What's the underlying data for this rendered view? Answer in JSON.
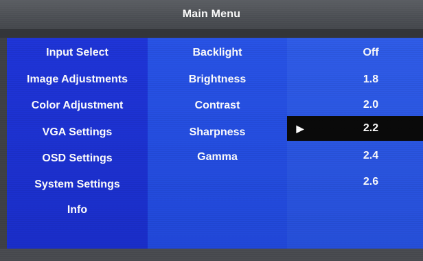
{
  "header": {
    "title": "Main Menu"
  },
  "left_menu": {
    "items": [
      {
        "label": "Input Select"
      },
      {
        "label": "Image Adjustments"
      },
      {
        "label": "Color Adjustment"
      },
      {
        "label": "VGA Settings"
      },
      {
        "label": "OSD Settings"
      },
      {
        "label": "System Settings"
      },
      {
        "label": "Info"
      }
    ]
  },
  "sub_menu": {
    "items": [
      {
        "label": "Backlight"
      },
      {
        "label": "Brightness"
      },
      {
        "label": "Contrast"
      },
      {
        "label": "Sharpness"
      },
      {
        "label": "Gamma"
      }
    ]
  },
  "value_list": {
    "selected_index": 3,
    "selected_indicator_icon": "play-triangle-icon",
    "items": [
      {
        "label": "Off"
      },
      {
        "label": "1.8"
      },
      {
        "label": "2.0"
      },
      {
        "label": "2.2"
      },
      {
        "label": "2.4"
      },
      {
        "label": "2.6"
      }
    ]
  },
  "colors": {
    "left_panel": "#1f35d8",
    "middle_panel": "#2853e6",
    "right_panel": "#2f5ce8",
    "selection_highlight": "#0a0a0a",
    "title_bar": "#55585d",
    "text": "#ffffff"
  }
}
